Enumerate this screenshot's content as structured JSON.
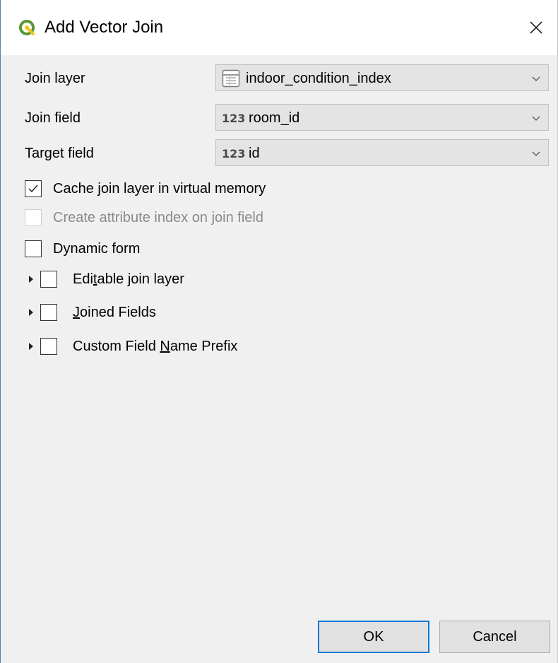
{
  "window": {
    "title": "Add Vector Join"
  },
  "form": {
    "join_layer": {
      "label": "Join layer",
      "value": "indoor_condition_index"
    },
    "join_field": {
      "label": "Join field",
      "type_badge": "123",
      "value": "room_id"
    },
    "target_field": {
      "label": "Target field",
      "type_badge": "123",
      "value": "id"
    }
  },
  "options": {
    "cache": {
      "label": "Cache join layer in virtual memory",
      "checked": true
    },
    "attr_index": {
      "label": "Create attribute index on join field",
      "checked": false,
      "enabled": false
    },
    "dynamic_form": {
      "label": "Dynamic form",
      "checked": false
    }
  },
  "groups": {
    "editable": {
      "label_pre": "Edi",
      "label_ul": "t",
      "label_post": "able join layer",
      "checked": false
    },
    "joined_fields": {
      "label_pre": "",
      "label_ul": "J",
      "label_post": "oined Fields",
      "checked": false
    },
    "prefix": {
      "label_pre": "Custom Field ",
      "label_ul": "N",
      "label_post": "ame Prefix",
      "checked": false
    }
  },
  "buttons": {
    "ok": "OK",
    "cancel": "Cancel"
  },
  "colors": {
    "accent": "#0078d7",
    "qgis_green": "#589632",
    "qgis_yellow": "#f0c419"
  }
}
